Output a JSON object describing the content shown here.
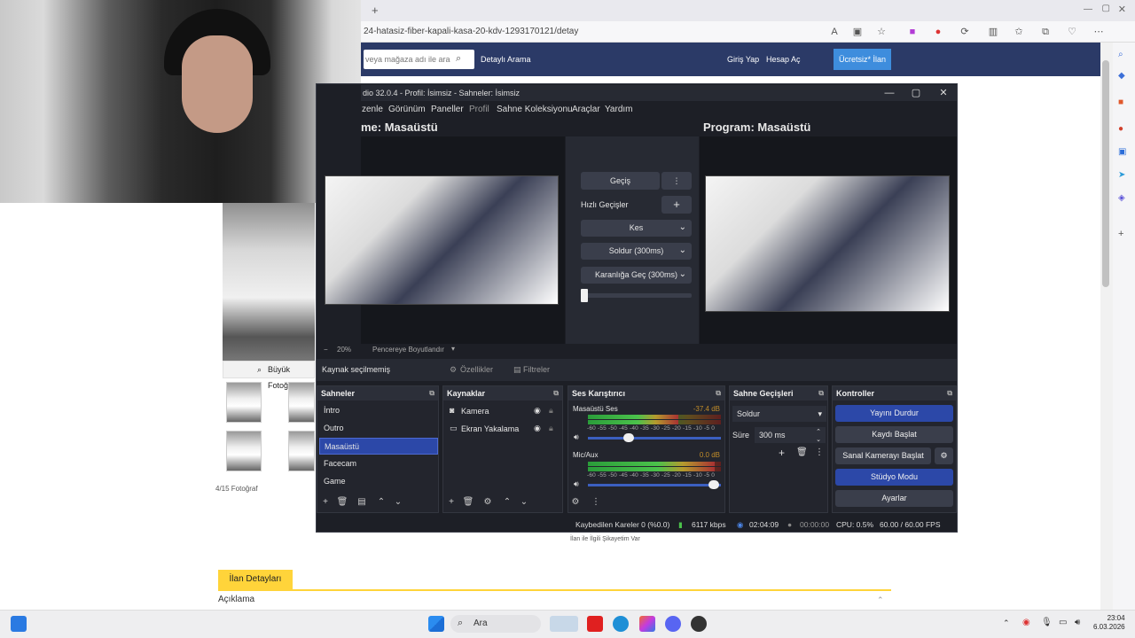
{
  "browser": {
    "url": "24-hatasiz-fiber-kapali-kasa-20-kdv-1293170121/detay",
    "search_placeholder": "veya mağaza adı ile ara",
    "detailed_search": "Detaylı Arama",
    "login": "Giriş Yap",
    "register": "Hesap Aç",
    "post_ad": "Ücretsiz* İlan Ver"
  },
  "listing": {
    "big_photo": "Büyük Fotoğr",
    "photo_count": "4/15 Fotoğraf",
    "report": "İlan ile İlgili Şikayetim Var",
    "details_tab": "İlan Detayları",
    "description": "Açıklama"
  },
  "obs": {
    "title": "dio 32.0.4 - Profil: İsimsiz - Sahneler: İsimsiz",
    "menu": [
      "zenle",
      "Görünüm",
      "Paneller",
      "Profil",
      "Sahne Koleksiyonu",
      "Araçlar",
      "Yardım"
    ],
    "preview_label": "me: Masaüstü",
    "program_label": "Program: Masaüstü",
    "transition_button": "Geçiş",
    "quick_transitions": "Hızlı Geçişler",
    "quick_list": [
      "Kes",
      "Soldur (300ms)",
      "Karanlığa Geç (300ms)"
    ],
    "zoom": "20%",
    "fit_window": "Pencereye Boyutlandır",
    "no_source": "Kaynak seçilmemiş",
    "properties": "Özellikler",
    "filters": "Filtreler",
    "panels": {
      "scenes": "Sahneler",
      "sources": "Kaynaklar",
      "mixer": "Ses Karıştırıcı",
      "transitions": "Sahne Geçişleri",
      "controls": "Kontroller"
    },
    "scenes": [
      "İntro",
      "Outro",
      "Masaüstü",
      "Facecam",
      "Game"
    ],
    "selected_scene_index": 2,
    "sources": [
      "Kamera",
      "Ekran Yakalama"
    ],
    "mixer": [
      {
        "name": "Masaüstü Ses",
        "db": "-37.4 dB",
        "level": 0.68
      },
      {
        "name": "Mic/Aux",
        "db": "0.0 dB",
        "level": 0.95
      }
    ],
    "meter_scale": "-60 -55 -50 -45 -40 -35 -30 -25 -20 -15 -10 -5 0",
    "transition_type": "Soldur",
    "duration_label": "Süre",
    "duration_value": "300 ms",
    "controls": [
      "Yayını Durdur",
      "Kaydı Başlat",
      "Sanal Kamerayı Başlat",
      "Stüdyo Modu",
      "Ayarlar"
    ],
    "status": {
      "dropped": "Kaybedilen Kareler 0 (%0.0)",
      "bitrate": "6117 kbps",
      "stream_time": "02:04:09",
      "rec_time": "00:00:00",
      "cpu": "CPU: 0.5%",
      "fps": "60.00 / 60.00 FPS"
    }
  },
  "taskbar": {
    "search": "Ara",
    "time": "23:04",
    "date": "6.03.2026"
  },
  "colors": {
    "accent_blue": "#2c48a8",
    "yellow_tab": "#ffd43a",
    "site_header": "#2b3a67"
  }
}
